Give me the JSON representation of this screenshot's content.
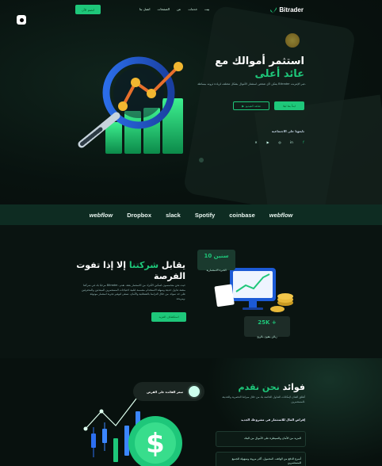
{
  "header": {
    "logo_text": "Bitrader",
    "cta_label": "انضم الآن",
    "nav": [
      "بيت",
      "خدمات",
      "عن",
      "الصفحات",
      "اتصل بنا"
    ]
  },
  "hero": {
    "title_line1": "استثمر أموالك مع",
    "title_line2": "عائد أعلى",
    "description": "يمكن لأي شخص استثمار الأموال بشكل مختلف لزيادة ثروته ببساطة Bitrader عبر الإنترنت.",
    "primary_button": "ابدأ بما ليلا",
    "outline_button": "شاهد الفيديو",
    "follow_label": "تابعونا على الاجتماعية",
    "social_icons": [
      "facebook-icon",
      "linkedin-icon",
      "instagram-icon",
      "youtube-icon",
      "twitter-icon"
    ]
  },
  "partners": [
    "webflow",
    "Dropbox",
    "slack",
    "Spotify",
    "coinbase",
    "webflow"
  ],
  "about": {
    "title_line1_a": "يقابل ",
    "title_line1_green": "شركتنا",
    "title_line1_b": " إلا إذا تفوت",
    "title_line2": "الفرصة",
    "description": "مرحبًا بك في شركتنا Bitrader، حيث نحن متحمسون لتمكين الأفراد من الاستثمار بثقة. نقدم منصة تداول حديثة وسهلة الاستخدام مصممة لتلبية احتياجات المستثمرين المبتدئين والمحترفين على حد سواء. من خلال التزامنا بالشفافية والأمان، نسعى لتوفير تجربة استثمار موثوقة ومربحة.",
    "button": "استكشاف المزيد",
    "years_value": "10 سنين",
    "years_label": "الخبرة الاستثمارية",
    "clients_value": "25K +",
    "clients_label": "زبائن يثقون بالربح"
  },
  "benefits": {
    "title_a": "فوائد",
    "title_green": " نحن نقدم",
    "description": "أطلق العنان لإمكانات التداول الخاصة بك من خلال ميزاتنا الحصرية والحديثة للمستثمرين.",
    "subtitle": "إقراض المال للاستثمار في مشروعك الجديد",
    "items": [
      "المزيد من الأمان والسيطرة على الأموال من البنك",
      "أسرع الدفع من الهاتف، المحمول، أكثر مرونة وسهولة للجميع للمستثمرين"
    ],
    "pill_label": "سعر الفائدة على القرض"
  }
}
